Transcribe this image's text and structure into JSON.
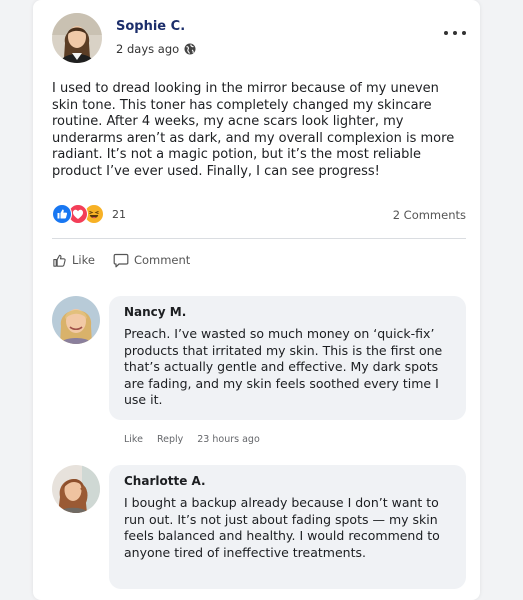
{
  "post": {
    "author": "Sophie C.",
    "timestamp": "2 days ago",
    "privacy_icon": "globe-icon",
    "body": "I used to dread looking in the mirror because of my uneven skin tone. This toner has completely changed my skincare routine. After 4 weeks, my acne scars look lighter, my underarms aren’t as dark, and my overall complexion is more radiant. It’s not a magic potion, but it’s the most reliable product I’ve ever used. Finally, I can see progress!",
    "reactions": {
      "icons": [
        "like-reaction-icon",
        "love-reaction-icon",
        "haha-reaction-icon"
      ],
      "count": "21"
    },
    "comments_count": "2 Comments",
    "actions": {
      "like": "Like",
      "comment": "Comment"
    }
  },
  "comments": [
    {
      "name": "Nancy M.",
      "text": "Preach. I’ve wasted so much money on ‘quick-fix’ products that irritated my skin. This is the first one that’s actually gentle and effective. My dark spots are fading, and my skin feels soothed every time I use it.",
      "like_label": "Like",
      "reply_label": "Reply",
      "timestamp": "23 hours ago"
    },
    {
      "name": "Charlotte A.",
      "text": "I bought a backup already because I don’t want to run out. It’s not just about fading spots — my skin feels balanced and healthy. I would recommend to anyone tired of ineffective treatments."
    }
  ],
  "colors": {
    "author_name": "#1c2e6b",
    "like_blue": "#1877f2",
    "love_red": "#f33e58",
    "haha_yellow": "#f7b125",
    "bubble_bg": "#f0f2f5"
  }
}
